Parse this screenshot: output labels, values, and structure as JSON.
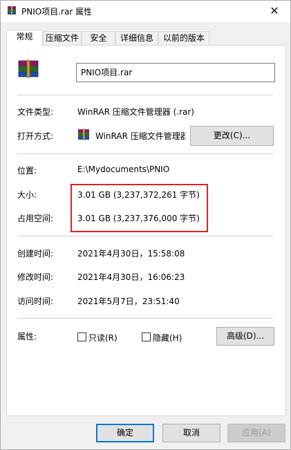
{
  "window": {
    "title": "PNIO项目.rar 属性",
    "close_glyph": "✕"
  },
  "tabs": [
    {
      "label": "常规",
      "active": true
    },
    {
      "label": "压缩文件",
      "active": false
    },
    {
      "label": "安全",
      "active": false
    },
    {
      "label": "详细信息",
      "active": false
    },
    {
      "label": "以前的版本",
      "active": false
    }
  ],
  "general": {
    "file_name": "PNIO项目.rar",
    "file_type_label": "文件类型:",
    "file_type_value": "WinRAR 压缩文件管理器 (.rar)",
    "open_with_label": "打开方式:",
    "open_with_value": "WinRAR 压缩文件管理器",
    "change_button": "更改(C)...",
    "location_label": "位置:",
    "location_value": "E:\\Mydocuments\\PNIO",
    "size_label": "大小:",
    "size_value": "3.01 GB (3,237,372,261 字节)",
    "size_on_disk_label": "占用空间:",
    "size_on_disk_value": "3.01 GB (3,237,376,000 字节)",
    "created_label": "创建时间:",
    "created_value": "2021年4月30日，15:58:08",
    "modified_label": "修改时间:",
    "modified_value": "2021年4月30日，16:06:23",
    "accessed_label": "访问时间:",
    "accessed_value": "2021年5月7日，23:51:40",
    "attributes_label": "属性:",
    "readonly_label": "只读(R)",
    "readonly_checked": false,
    "hidden_label": "隐藏(H)",
    "hidden_checked": false,
    "advanced_button": "高级(D)..."
  },
  "footer": {
    "ok": "确定",
    "cancel": "取消",
    "apply": "应用(A)"
  },
  "colors": {
    "highlight": "#e02020",
    "default_button_border": "#0078d7",
    "winrar_book_colors": [
      "#8b1a6b",
      "#2d6a2d",
      "#1f4fa3",
      "#c89b2a"
    ]
  }
}
